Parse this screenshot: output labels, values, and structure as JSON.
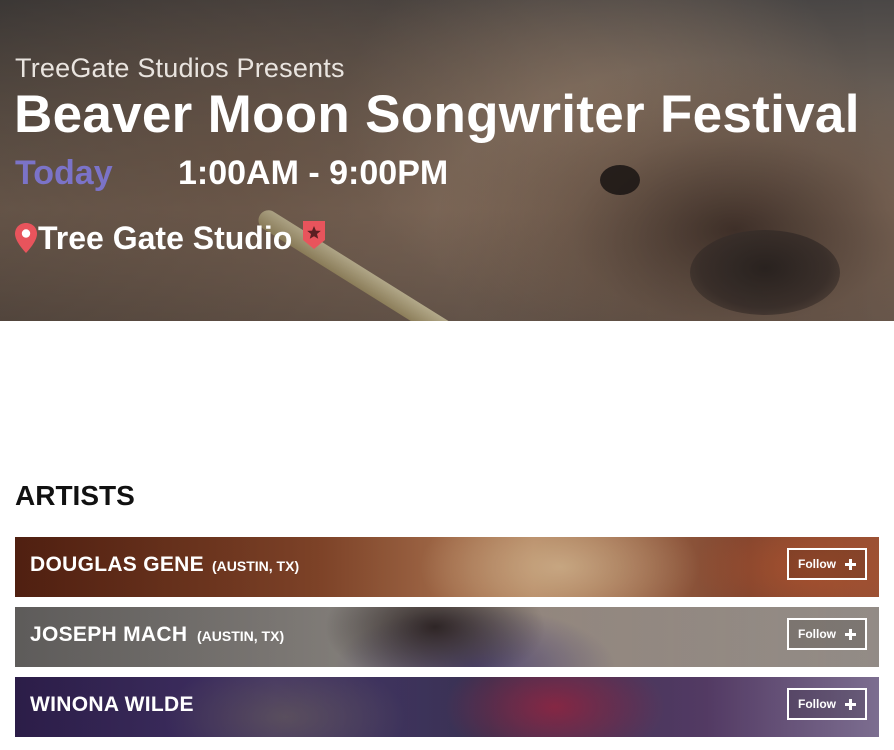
{
  "event": {
    "presenter": "TreeGate Studios Presents",
    "title": "Beaver Moon Songwriter Festival",
    "date_label": "Today",
    "time_range": "1:00AM - 9:00PM",
    "venue": "Tree Gate Studio",
    "icons": {
      "location": "map-pin-icon",
      "venue_badge": "star-badge-icon"
    },
    "colors": {
      "date": "#7b73c8",
      "pin": "#e8545c"
    }
  },
  "artists_section": {
    "heading": "ARTISTS",
    "items": [
      {
        "name": "DOUGLAS GENE",
        "location": "(AUSTIN, TX)",
        "follow_label": "Follow"
      },
      {
        "name": "JOSEPH MACH",
        "location": "(AUSTIN, TX)",
        "follow_label": "Follow"
      },
      {
        "name": "WINONA WILDE",
        "location": "",
        "follow_label": "Follow"
      }
    ]
  }
}
